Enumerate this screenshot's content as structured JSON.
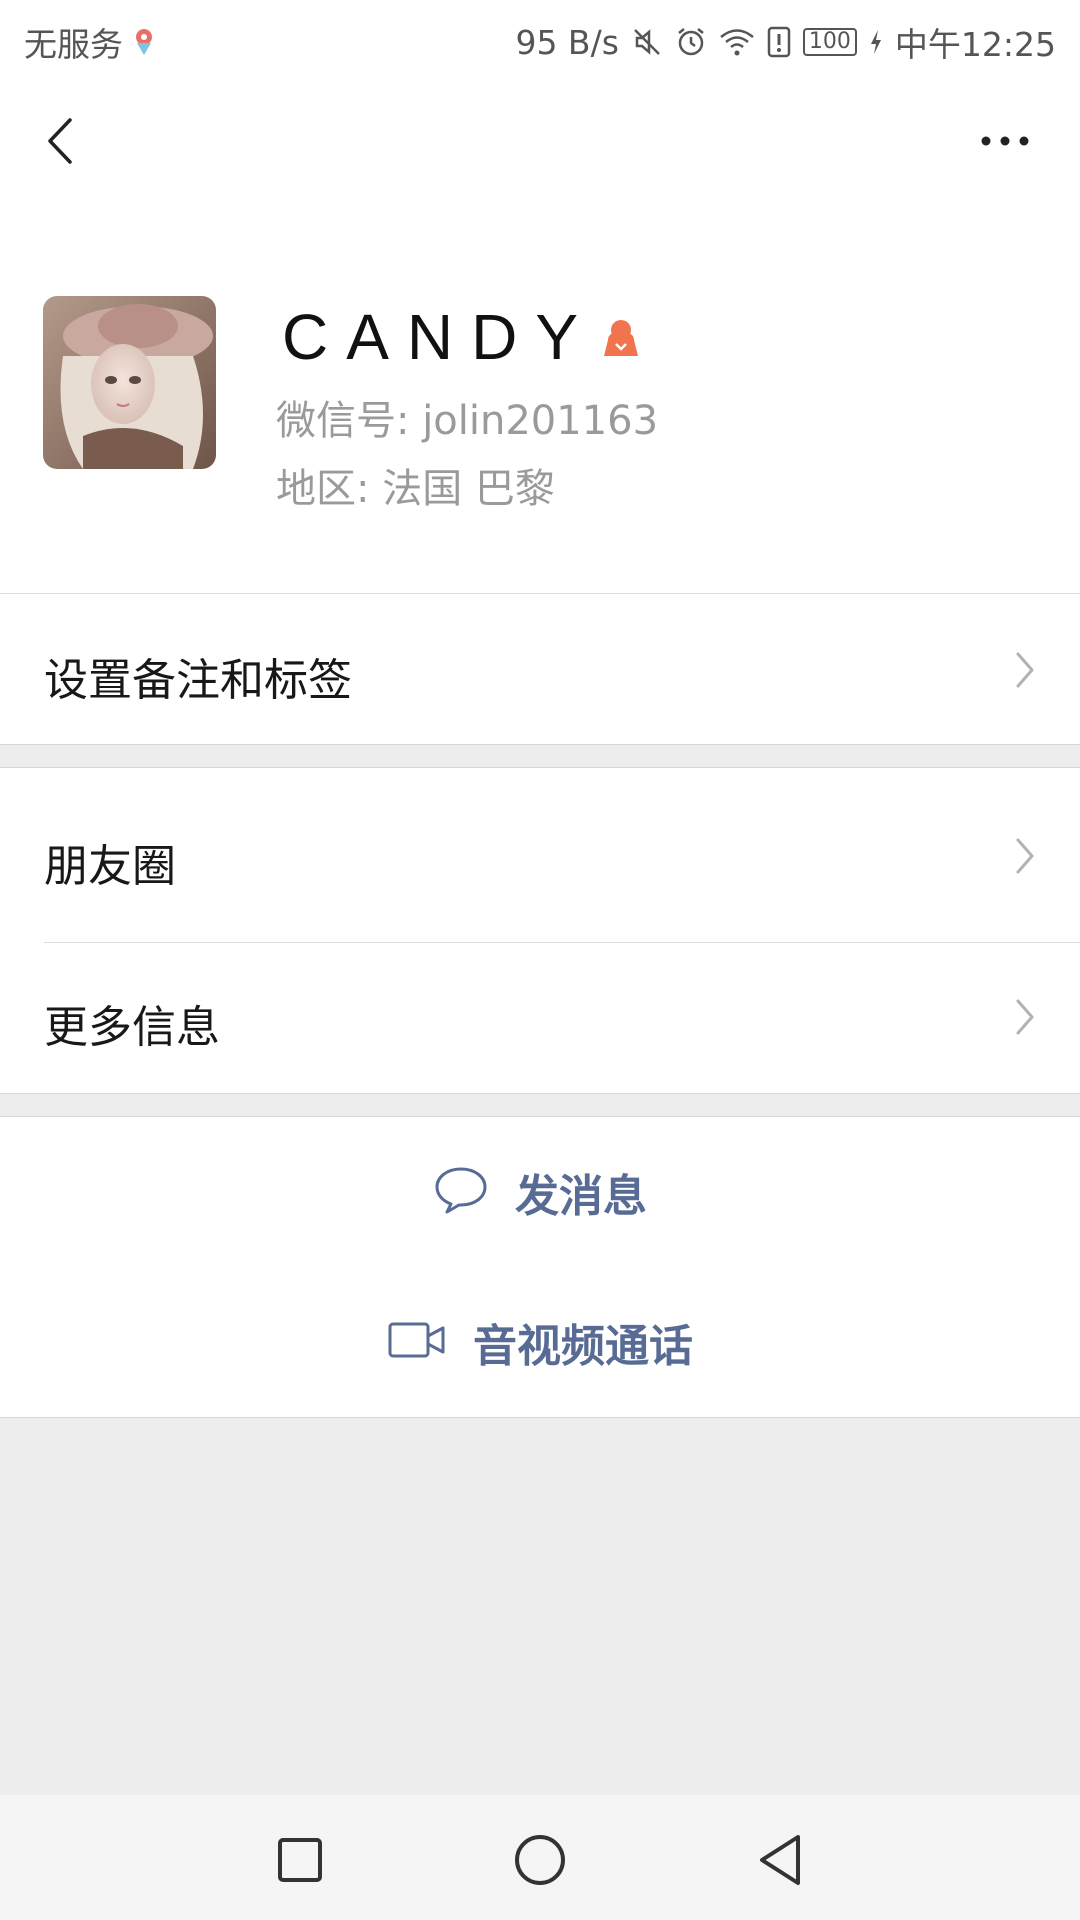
{
  "status_bar": {
    "carrier": "无服务",
    "net_speed": "95 B/s",
    "battery": "100",
    "time": "中午12:25"
  },
  "header": {
    "back_icon": "chevron-left-icon",
    "more_icon": "more-dots-icon"
  },
  "profile": {
    "name": "CANDY",
    "gender_icon": "female-icon",
    "gender_color": "#f0744e",
    "wechat_id": "微信号: jolin201163",
    "region": "地区: 法国  巴黎"
  },
  "rows": {
    "remark": "设置备注和标签",
    "moments": "朋友圈",
    "more_info": "更多信息"
  },
  "actions": {
    "message": "发消息",
    "call": "音视频通话",
    "accent": "#576b95"
  },
  "navbar": {
    "recent_icon": "square-icon",
    "home_icon": "circle-icon",
    "back_icon": "triangle-back-icon"
  }
}
